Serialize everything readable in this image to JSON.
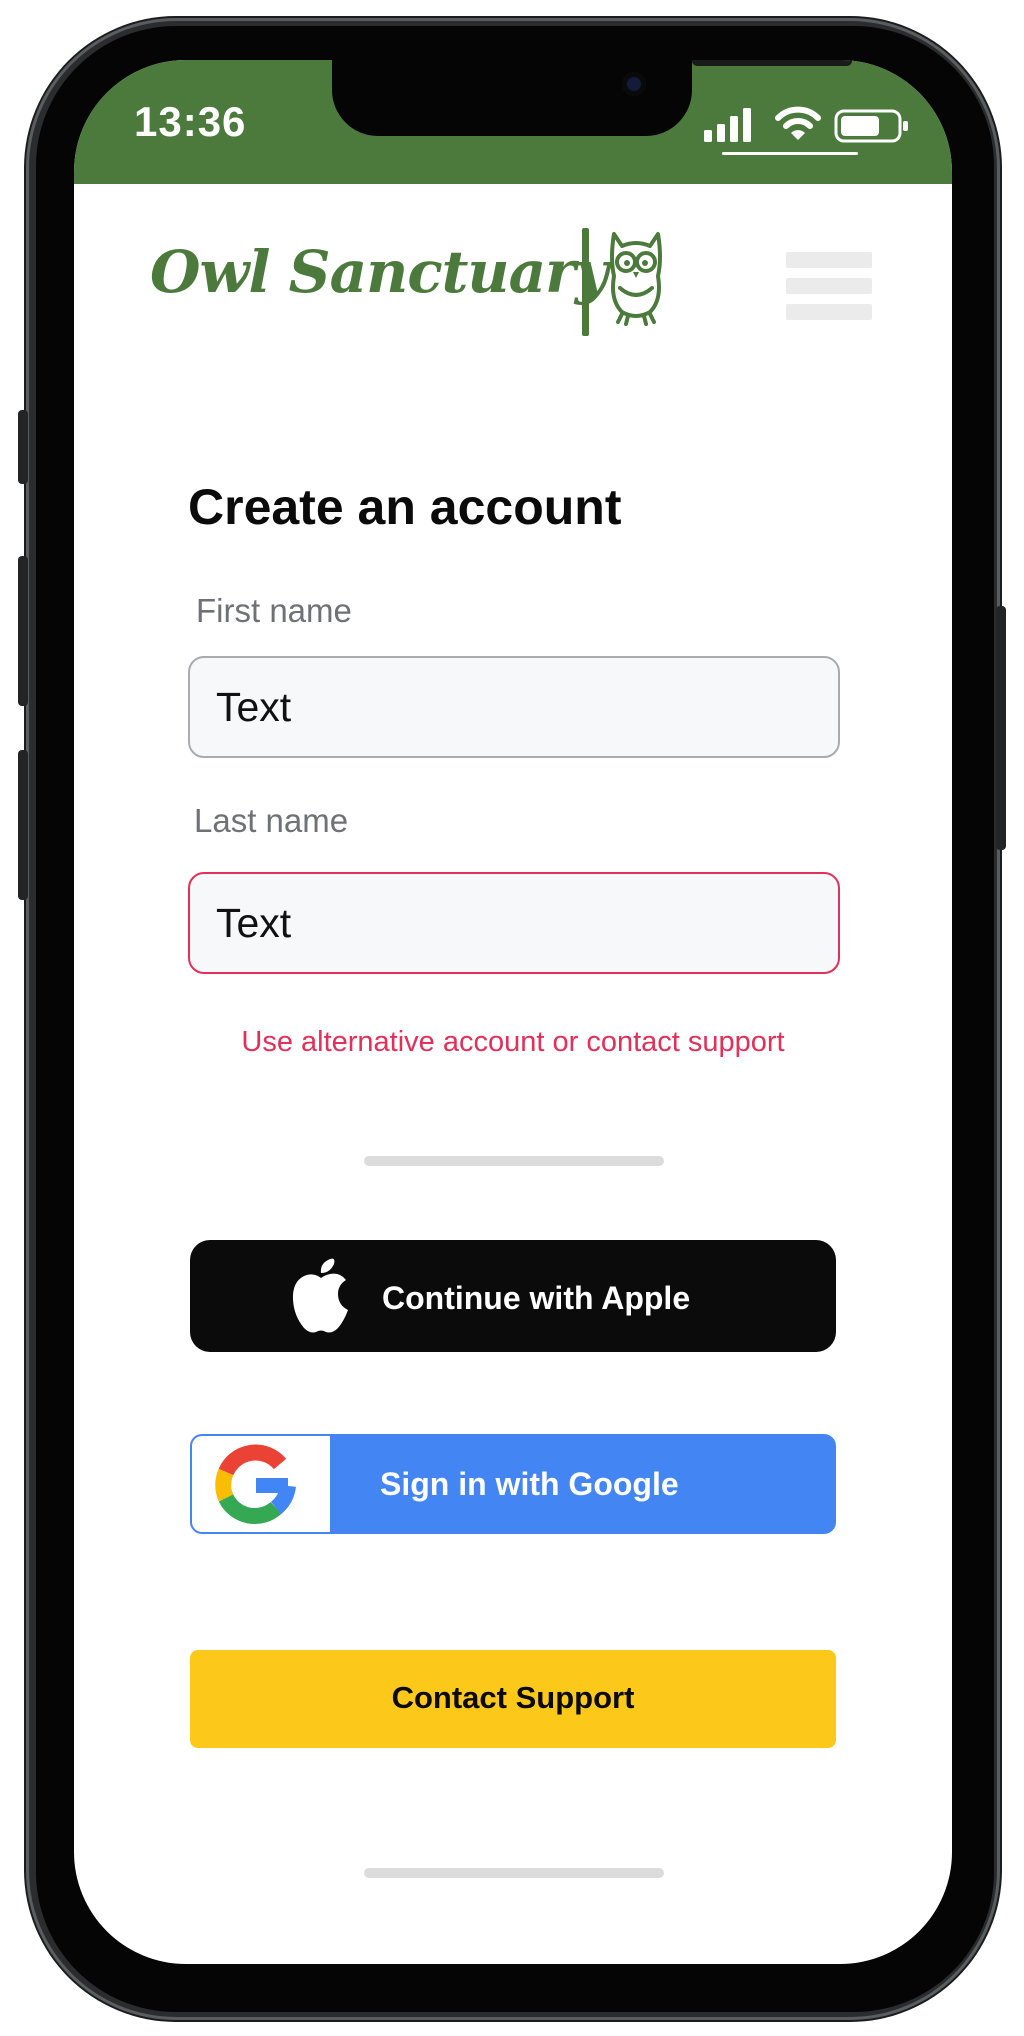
{
  "status_bar": {
    "time": "13:36",
    "background_color": "#4c7a3d",
    "icons": [
      "signal-icon",
      "wifi-icon",
      "battery-icon"
    ]
  },
  "header": {
    "brand_name": "Owl Sanctuary",
    "brand_color": "#4c7a3d",
    "logo_icon": "owl-icon",
    "menu_icon": "hamburger-menu-icon"
  },
  "form": {
    "title": "Create an account",
    "first_name": {
      "label": "First name",
      "value": "Text"
    },
    "last_name": {
      "label": "Last name",
      "value": "Text",
      "state": "error"
    },
    "error_message": "Use alternative account or contact support",
    "error_color": "#e1305a"
  },
  "buttons": {
    "apple": {
      "label": "Continue with Apple",
      "icon": "apple-logo-icon",
      "color": "#0b0b0b"
    },
    "google": {
      "label": "Sign in with Google",
      "icon": "google-logo-icon",
      "color": "#4485f4"
    },
    "support": {
      "label": "Contact Support",
      "color": "#fcc91a"
    }
  }
}
